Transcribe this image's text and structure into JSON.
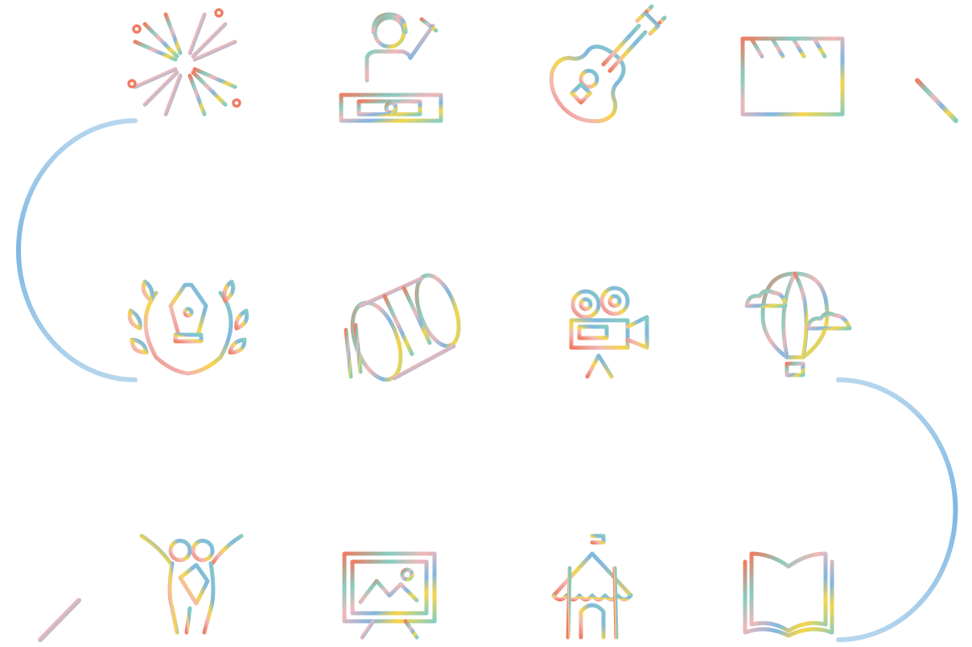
{
  "palette": {
    "coral": "#EF7D63",
    "teal": "#86CDC0",
    "pink": "#F2B8B8",
    "yellow": "#F8D648",
    "blue": "#7FB7E2",
    "light_blue": "#B6D6EE"
  },
  "icons": [
    {
      "id": "fireworks",
      "name": "fireworks-icon"
    },
    {
      "id": "dj",
      "name": "dj-icon"
    },
    {
      "id": "guitar",
      "name": "guitar-icon"
    },
    {
      "id": "clapperboard",
      "name": "clapperboard-icon"
    },
    {
      "id": "fountain-pen-award",
      "name": "fountain-pen-award-icon"
    },
    {
      "id": "drum",
      "name": "drum-icon"
    },
    {
      "id": "movie-camera",
      "name": "movie-camera-icon"
    },
    {
      "id": "hot-air-balloon",
      "name": "hot-air-balloon-icon"
    },
    {
      "id": "dancers",
      "name": "dancers-icon"
    },
    {
      "id": "painting-easel",
      "name": "painting-easel-icon"
    },
    {
      "id": "circus-tent",
      "name": "circus-tent-icon"
    },
    {
      "id": "open-book",
      "name": "open-book-icon"
    }
  ]
}
